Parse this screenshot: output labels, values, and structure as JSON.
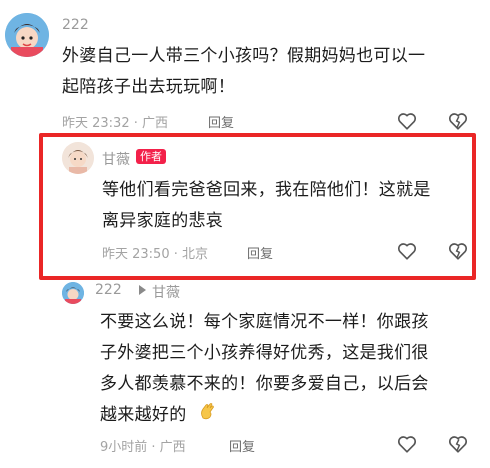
{
  "comments": [
    {
      "user": "222",
      "text_lines": [
        "外婆自己一人带三个小孩吗？假期妈妈也可以一",
        "起陪孩子出去玩玩啊！"
      ],
      "meta": "昨天 23:32 · 广西",
      "reply_label": "回复"
    },
    {
      "user": "甘薇",
      "badge": "作者",
      "text_lines": [
        "等他们看完爸爸回来，我在陪他们！这就是",
        "离异家庭的悲哀"
      ],
      "meta": "昨天 23:50 · 北京",
      "reply_label": "回复"
    },
    {
      "user": "222",
      "reply_to": "甘薇",
      "text_lines": [
        "不要这么说！每个家庭情况不一样！你跟孩",
        "子外婆把三个小孩养得好优秀，这是我们很",
        "多人都羡慕不来的！你要多爱自己，以后会",
        "越来越好的"
      ],
      "meta": "9小时前 · 广西",
      "reply_label": "回复"
    }
  ],
  "colors": {
    "highlight_border": "#ea2626",
    "badge_bg": "#f3214a"
  }
}
